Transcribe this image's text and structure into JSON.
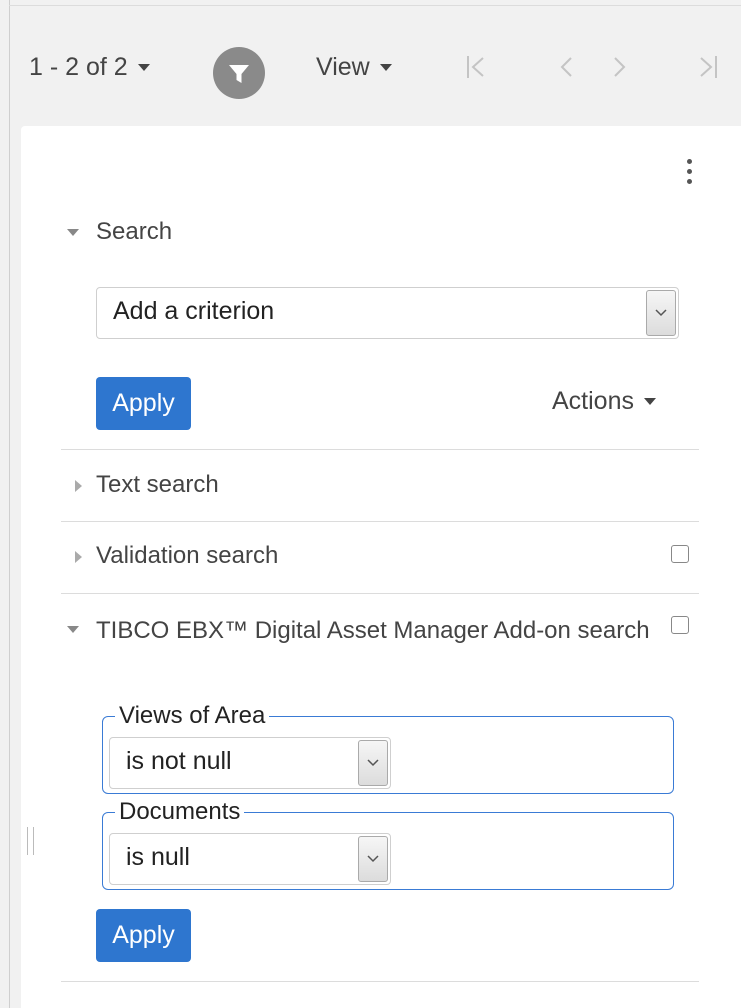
{
  "toolbar": {
    "pagination_label": "1 - 2 of 2",
    "view_label": "View"
  },
  "search": {
    "title": "Search",
    "criterion_value": "Add a criterion",
    "apply_label": "Apply",
    "actions_label": "Actions"
  },
  "text_search": {
    "title": "Text search"
  },
  "validation_search": {
    "title": "Validation search"
  },
  "dam_search": {
    "title": "TIBCO EBX™ Digital Asset Manager Add-on search",
    "fields": [
      {
        "label": "Views of Area",
        "value": "is not null"
      },
      {
        "label": "Documents",
        "value": "is null"
      }
    ],
    "apply_label": "Apply"
  },
  "colors": {
    "primary": "#2e76cf",
    "fieldset_border": "#3a7bd5",
    "toolbar_bg": "#f1f1f1",
    "filter_icon_bg": "#8a8a8a"
  },
  "icons": [
    "caret-down-icon",
    "filter-icon",
    "first-page-icon",
    "prev-page-icon",
    "next-page-icon",
    "last-page-icon",
    "kebab-menu-icon",
    "expand-icon",
    "collapse-icon",
    "checkbox-icon"
  ]
}
